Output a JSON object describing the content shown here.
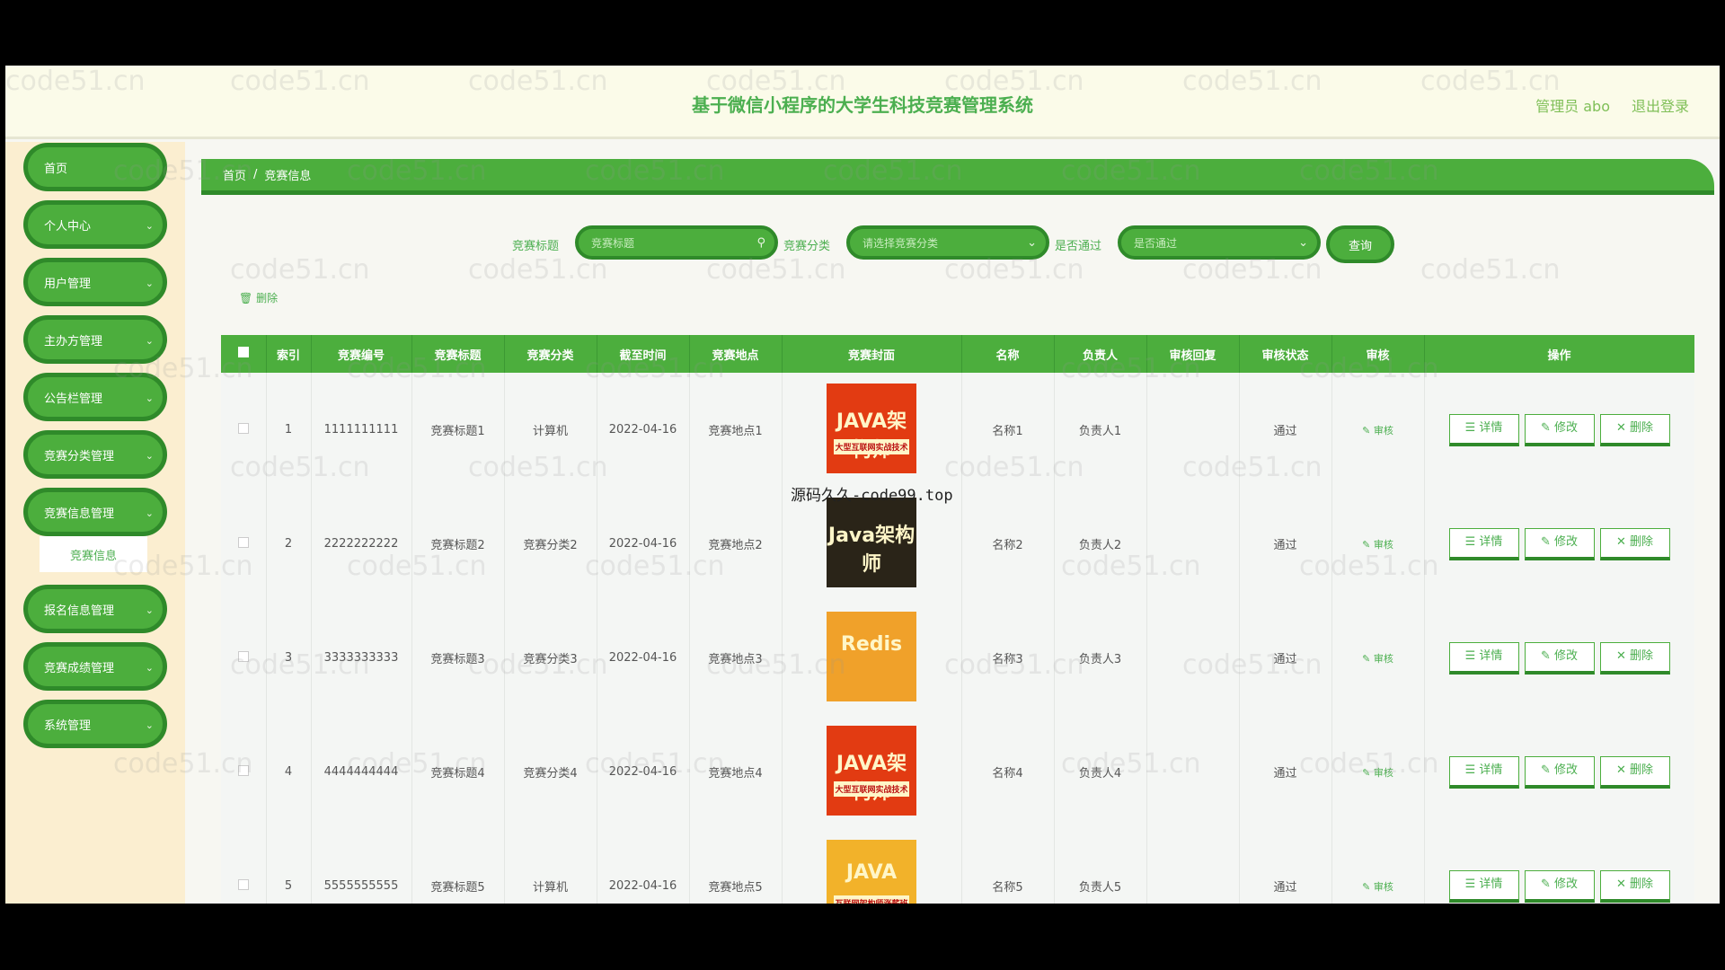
{
  "header": {
    "title": "基于微信小程序的大学生科技竞赛管理系统",
    "admin": "管理员 abo",
    "logout": "退出登录"
  },
  "sidebar": {
    "items": [
      {
        "label": "首页",
        "has_arrow": false
      },
      {
        "label": "个人中心",
        "has_arrow": true
      },
      {
        "label": "用户管理",
        "has_arrow": true
      },
      {
        "label": "主办方管理",
        "has_arrow": true
      },
      {
        "label": "公告栏管理",
        "has_arrow": true
      },
      {
        "label": "竞赛分类管理",
        "has_arrow": true
      },
      {
        "label": "竞赛信息管理",
        "has_arrow": true
      },
      {
        "label": "报名信息管理",
        "has_arrow": true
      },
      {
        "label": "竞赛成绩管理",
        "has_arrow": true
      },
      {
        "label": "系统管理",
        "has_arrow": true
      }
    ],
    "submenu": "竞赛信息"
  },
  "breadcrumb": {
    "home": "首页",
    "sep": "/",
    "current": "竞赛信息"
  },
  "filters": {
    "title_label": "竞赛标题",
    "title_placeholder": "竞赛标题",
    "category_label": "竞赛分类",
    "category_placeholder": "请选择竞赛分类",
    "pass_label": "是否通过",
    "pass_placeholder": "是否通过",
    "query": "查询"
  },
  "batch_delete": "删除",
  "table": {
    "headers": [
      "索引",
      "竞赛编号",
      "竞赛标题",
      "竞赛分类",
      "截至时间",
      "竞赛地点",
      "竞赛封面",
      "名称",
      "负责人",
      "审核回复",
      "审核状态",
      "审核",
      "操作"
    ],
    "rows": [
      {
        "idx": "1",
        "code": "1111111111",
        "title": "竞赛标题1",
        "category": "计算机",
        "deadline": "2022-04-16",
        "place": "竞赛地点1",
        "cover_text": "JAVA架构师",
        "cover_sub": "大型互联网实战技术",
        "cover_color": "#e23b12",
        "name": "名称1",
        "owner": "负责人1",
        "reply": "",
        "status": "通过"
      },
      {
        "idx": "2",
        "code": "2222222222",
        "title": "竞赛标题2",
        "category": "竞赛分类2",
        "deadline": "2022-04-16",
        "place": "竞赛地点2",
        "cover_text": "Java架构师",
        "cover_sub": "",
        "cover_color": "#2a2418",
        "name": "名称2",
        "owner": "负责人2",
        "reply": "",
        "status": "通过"
      },
      {
        "idx": "3",
        "code": "3333333333",
        "title": "竞赛标题3",
        "category": "竞赛分类3",
        "deadline": "2022-04-16",
        "place": "竞赛地点3",
        "cover_text": "Redis",
        "cover_sub": "",
        "cover_color": "#f0a12a",
        "name": "名称3",
        "owner": "负责人3",
        "reply": "",
        "status": "通过"
      },
      {
        "idx": "4",
        "code": "4444444444",
        "title": "竞赛标题4",
        "category": "竞赛分类4",
        "deadline": "2022-04-16",
        "place": "竞赛地点4",
        "cover_text": "JAVA架构师",
        "cover_sub": "大型互联网实战技术",
        "cover_color": "#e23b12",
        "name": "名称4",
        "owner": "负责人4",
        "reply": "",
        "status": "通过"
      },
      {
        "idx": "5",
        "code": "5555555555",
        "title": "竞赛标题5",
        "category": "计算机",
        "deadline": "2022-04-16",
        "place": "竞赛地点5",
        "cover_text": "JAVA",
        "cover_sub": "互联网架构师涨薪班",
        "cover_color": "#f2b22a",
        "name": "名称5",
        "owner": "负责人5",
        "reply": "",
        "status": "通过"
      }
    ],
    "audit_label": "审核",
    "ops": {
      "detail": "详情",
      "edit": "修改",
      "delete": "删除"
    }
  },
  "overlay_watermark": "源码久久-code99.top",
  "bg_watermark": "code51.cn",
  "colors": {
    "primary": "#4cae3d",
    "primary_dark": "#2f8a2a",
    "sidebar_bg": "#fbeed0",
    "text_green": "#4caf50"
  }
}
